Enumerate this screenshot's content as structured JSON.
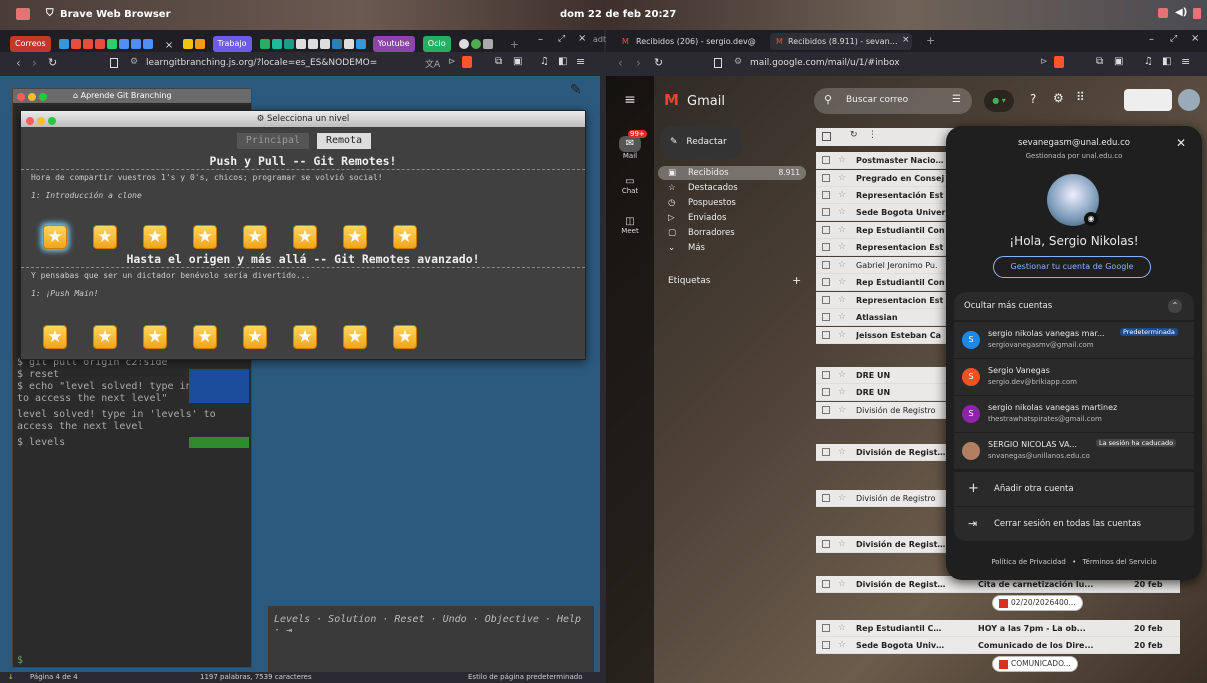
{
  "system": {
    "browser_name": "Brave Web Browser",
    "datetime": "dom 22 de feb  20:27"
  },
  "left_browser": {
    "tabs": {
      "correos": "Correos",
      "trabajo": "Trabajo",
      "youtube": "Youtube",
      "ocio": "Ocio",
      "close": "×",
      "newtab": "+"
    },
    "url": "learngitbranching.js.org/?locale=es_ES&NODEMO="
  },
  "lgb": {
    "app_title": "Aprende Git Branching",
    "modal_title": "Selecciona un nivel",
    "tabs": [
      "Principal",
      "Remota"
    ],
    "sections": [
      {
        "title": "Push y Pull -- Git Remotes!",
        "desc": "Hora de compartir vuestros 1's y 0's, chicos; programar se volvió social!",
        "level": "1: Introducción a clone",
        "stars": 8
      },
      {
        "title": "Hasta el origen y más allá -- Git Remotes avanzado!",
        "desc": "Y pensabas que ser un dictador benévolo sería divertido...",
        "level": "1: ¡Push Main!",
        "stars": 8
      }
    ],
    "terminal": {
      "lines": [
        "$ git pull origin c2:side",
        "$ reset",
        "$ echo \"level solved! type in 'levels'",
        "to access the next level\"",
        "level solved! type in 'levels' to",
        "access the next level",
        "$ levels"
      ]
    },
    "commands": "Levels · Solution · Reset · Undo · Objective · Help · ",
    "status": {
      "page": "Página 4 de 4",
      "words": "1197 palabras, 7539 caracteres",
      "style": "Estilo de página predeterminado"
    }
  },
  "right_browser": {
    "tabs": [
      "Recibidos (206) - sergio.dev@",
      "Recibidos (8.911) - sevaneg"
    ],
    "url": "mail.google.com/mail/u/1/#inbox",
    "partial_tab": "adt"
  },
  "gmail": {
    "logo": "Gmail",
    "search_placeholder": "Buscar correo",
    "compose": "Redactar",
    "rail": {
      "mail": "Mail",
      "chat": "Chat",
      "meet": "Meet",
      "badge": "99+"
    },
    "nav": [
      {
        "label": "Recibidos",
        "count": "8.911"
      },
      {
        "label": "Destacados",
        "count": ""
      },
      {
        "label": "Pospuestos",
        "count": ""
      },
      {
        "label": "Enviados",
        "count": ""
      },
      {
        "label": "Borradores",
        "count": ""
      },
      {
        "label": "Más",
        "count": ""
      }
    ],
    "labels_heading": "Etiquetas",
    "rows": [
      {
        "sender": "Postmaster Naciona",
        "subject": "",
        "date": "",
        "attach": ""
      },
      {
        "sender": "Pregrado en Consej",
        "subject": "",
        "date": "",
        "attach": ""
      },
      {
        "sender": "Representación Est",
        "subject": "",
        "date": "",
        "attach": ""
      },
      {
        "sender": "Sede Bogota Univer",
        "subject": "",
        "date": "",
        "attach": ""
      },
      {
        "sender": "Rep Estudiantil Con",
        "subject": "",
        "date": "",
        "attach": ""
      },
      {
        "sender": "Representacion Est",
        "subject": "",
        "date": "",
        "attach": ""
      },
      {
        "sender": "Gabriel Jeronimo Pu.",
        "subject": "",
        "date": "",
        "attach": ""
      },
      {
        "sender": "Rep Estudiantil Con",
        "subject": "",
        "date": "",
        "attach": ""
      },
      {
        "sender": "Representacion Est",
        "subject": "",
        "date": "",
        "attach": ""
      },
      {
        "sender": "Atlassian",
        "subject": "",
        "date": "",
        "attach": ""
      },
      {
        "sender": "Jeisson Esteban Ca",
        "subject": "",
        "date": "",
        "attach": ""
      },
      {
        "sender": "DRE UN",
        "subject": "",
        "date": "",
        "attach": ""
      },
      {
        "sender": "DRE UN",
        "subject": "",
        "date": "",
        "attach": ""
      },
      {
        "sender": "División de Registro",
        "subject": "",
        "date": "",
        "attach": ""
      },
      {
        "sender": "División de Registro",
        "subject": "",
        "date": "",
        "attach": ""
      },
      {
        "sender": "División de Registro",
        "subject": "",
        "date": "",
        "attach": ""
      },
      {
        "sender": "División de Registro",
        "subject": "",
        "date": "",
        "attach": ""
      },
      {
        "sender": "División de Registro",
        "subject": "Cita de carnetización lu...",
        "date": "20 feb",
        "attach": "02/20/2026400..."
      },
      {
        "sender": "Rep Estudiantil Con.",
        "subject": "HOY a las 7pm - La ob...",
        "date": "20 feb",
        "attach": ""
      },
      {
        "sender": "Sede Bogota Univers.",
        "subject": "Comunicado de los Dire...",
        "date": "20 feb",
        "attach": "COMUNICADO..."
      }
    ],
    "account_panel": {
      "email": "sevanegasm@unal.edu.co",
      "managed": "Gestionada por unal.edu.co",
      "greeting": "¡Hola, Sergio Nikolas!",
      "manage_btn": "Gestionar tu cuenta de Google",
      "hide_more": "Ocultar más cuentas",
      "accounts": [
        {
          "initial": "S",
          "name": "sergio nikolas vanegas mar...",
          "email": "sergiovanegasmv@gmail.com",
          "tag": "Predeterminada",
          "color": "#1e88e5"
        },
        {
          "initial": "S",
          "name": "Sergio Vanegas",
          "email": "sergio.dev@brikiapp.com",
          "tag": "",
          "color": "#f4511e"
        },
        {
          "initial": "S",
          "name": "sergio nikolas vanegas martinez",
          "email": "thestrawhatspirates@gmail.com",
          "tag": "",
          "color": "#8e24aa"
        },
        {
          "initial": "",
          "name": "SERGIO NICOLAS VA...",
          "email": "snvanegas@unillanos.edu.co",
          "tag": "La sesión ha caducado",
          "color": "#b08060"
        }
      ],
      "add_account": "Añadir otra cuenta",
      "sign_out": "Cerrar sesión en todas las cuentas",
      "privacy": "Política de Privacidad",
      "terms": "Términos del Servicio",
      "dot": "•"
    }
  }
}
